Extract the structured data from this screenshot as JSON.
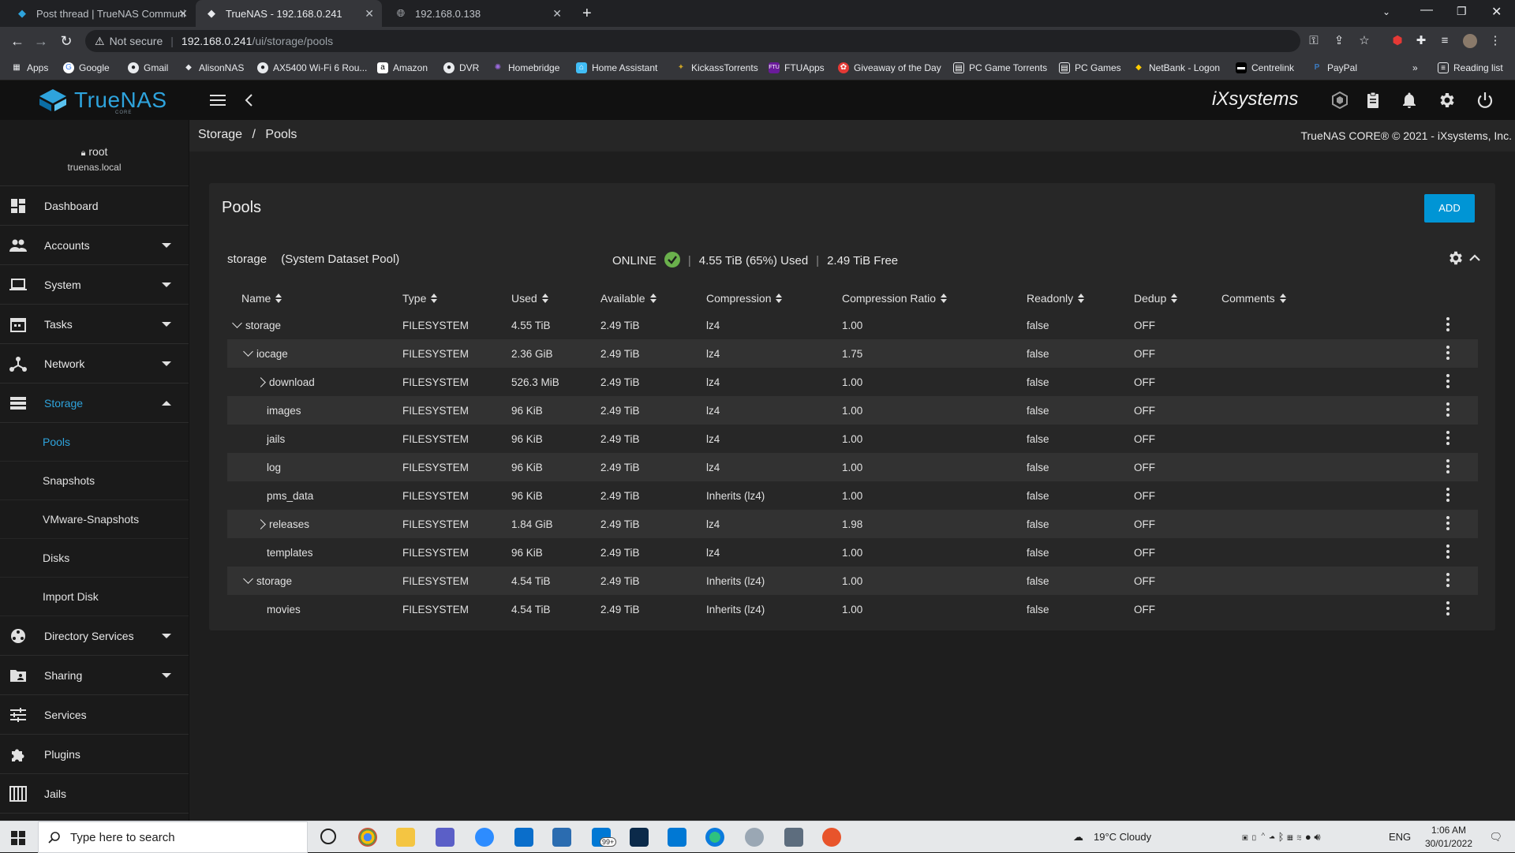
{
  "browser": {
    "tabs": [
      {
        "title": "Post thread | TrueNAS Communi",
        "active": false
      },
      {
        "title": "TrueNAS - 192.168.0.241",
        "active": true
      },
      {
        "title": "192.168.0.138",
        "active": false
      }
    ],
    "security": "Not secure",
    "url_host": "192.168.0.241",
    "url_path": "/ui/storage/pools",
    "bookmarks": [
      "Apps",
      "Google",
      "Gmail",
      "AlisonNAS",
      "AX5400 Wi-Fi 6 Rou...",
      "Amazon",
      "DVR",
      "Homebridge",
      "Home Assistant",
      "KickassTorrents",
      "FTUApps",
      "Giveaway of the Day",
      "PC Game Torrents",
      "PC Games",
      "NetBank - Logon",
      "Centrelink",
      "PayPal"
    ],
    "reading_list": "Reading list"
  },
  "app": {
    "logo_text": "TrueNAS",
    "logo_sub": "CORE",
    "vendor": "iXsystems"
  },
  "user": {
    "name": "root",
    "host": "truenas.local"
  },
  "nav": {
    "dashboard": "Dashboard",
    "accounts": "Accounts",
    "system": "System",
    "tasks": "Tasks",
    "network": "Network",
    "storage": "Storage",
    "storage_sub": [
      "Pools",
      "Snapshots",
      "VMware-Snapshots",
      "Disks",
      "Import Disk"
    ],
    "directory_services": "Directory Services",
    "sharing": "Sharing",
    "services": "Services",
    "plugins": "Plugins",
    "jails": "Jails"
  },
  "breadcrumb": {
    "parent": "Storage",
    "sep": "/",
    "current": "Pools"
  },
  "copyright": "TrueNAS CORE® © 2021 - iXsystems, Inc.",
  "pools": {
    "title": "Pools",
    "add_label": "ADD",
    "pool_name": "storage",
    "pool_note": "(System Dataset Pool)",
    "status": "ONLINE",
    "used_summary": "4.55 TiB (65%) Used",
    "free_summary": "2.49 TiB Free",
    "columns": [
      "Name",
      "Type",
      "Used",
      "Available",
      "Compression",
      "Compression Ratio",
      "Readonly",
      "Dedup",
      "Comments"
    ],
    "rows": [
      {
        "name": "storage",
        "expander": "down",
        "level": 0,
        "type": "FILESYSTEM",
        "used": "4.55 TiB",
        "available": "2.49 TiB",
        "compression": "lz4",
        "ratio": "1.00",
        "readonly": "false",
        "dedup": "OFF",
        "comments": ""
      },
      {
        "name": "iocage",
        "expander": "down",
        "level": 1,
        "type": "FILESYSTEM",
        "used": "2.36 GiB",
        "available": "2.49 TiB",
        "compression": "lz4",
        "ratio": "1.75",
        "readonly": "false",
        "dedup": "OFF",
        "comments": ""
      },
      {
        "name": "download",
        "expander": "right",
        "level": 2,
        "type": "FILESYSTEM",
        "used": "526.3 MiB",
        "available": "2.49 TiB",
        "compression": "lz4",
        "ratio": "1.00",
        "readonly": "false",
        "dedup": "OFF",
        "comments": ""
      },
      {
        "name": "images",
        "expander": "",
        "level": 2,
        "type": "FILESYSTEM",
        "used": "96 KiB",
        "available": "2.49 TiB",
        "compression": "lz4",
        "ratio": "1.00",
        "readonly": "false",
        "dedup": "OFF",
        "comments": ""
      },
      {
        "name": "jails",
        "expander": "",
        "level": 2,
        "type": "FILESYSTEM",
        "used": "96 KiB",
        "available": "2.49 TiB",
        "compression": "lz4",
        "ratio": "1.00",
        "readonly": "false",
        "dedup": "OFF",
        "comments": ""
      },
      {
        "name": "log",
        "expander": "",
        "level": 2,
        "type": "FILESYSTEM",
        "used": "96 KiB",
        "available": "2.49 TiB",
        "compression": "lz4",
        "ratio": "1.00",
        "readonly": "false",
        "dedup": "OFF",
        "comments": ""
      },
      {
        "name": "pms_data",
        "expander": "",
        "level": 2,
        "type": "FILESYSTEM",
        "used": "96 KiB",
        "available": "2.49 TiB",
        "compression": "Inherits (lz4)",
        "ratio": "1.00",
        "readonly": "false",
        "dedup": "OFF",
        "comments": ""
      },
      {
        "name": "releases",
        "expander": "right",
        "level": 2,
        "type": "FILESYSTEM",
        "used": "1.84 GiB",
        "available": "2.49 TiB",
        "compression": "lz4",
        "ratio": "1.98",
        "readonly": "false",
        "dedup": "OFF",
        "comments": ""
      },
      {
        "name": "templates",
        "expander": "",
        "level": 2,
        "type": "FILESYSTEM",
        "used": "96 KiB",
        "available": "2.49 TiB",
        "compression": "lz4",
        "ratio": "1.00",
        "readonly": "false",
        "dedup": "OFF",
        "comments": ""
      },
      {
        "name": "storage",
        "expander": "down",
        "level": 1,
        "type": "FILESYSTEM",
        "used": "4.54 TiB",
        "available": "2.49 TiB",
        "compression": "Inherits (lz4)",
        "ratio": "1.00",
        "readonly": "false",
        "dedup": "OFF",
        "comments": ""
      },
      {
        "name": "movies",
        "expander": "",
        "level": 2,
        "type": "FILESYSTEM",
        "used": "4.54 TiB",
        "available": "2.49 TiB",
        "compression": "Inherits (lz4)",
        "ratio": "1.00",
        "readonly": "false",
        "dedup": "OFF",
        "comments": ""
      }
    ]
  },
  "taskbar": {
    "search_placeholder": "Type here to search",
    "weather": "19°C  Cloudy",
    "lang": "ENG",
    "time": "1:06 AM",
    "date": "30/01/2022",
    "mail_badge": "99+"
  },
  "colors": {
    "accent": "#0095d5",
    "link": "#2ea3dc",
    "ok": "#6ab04c"
  }
}
